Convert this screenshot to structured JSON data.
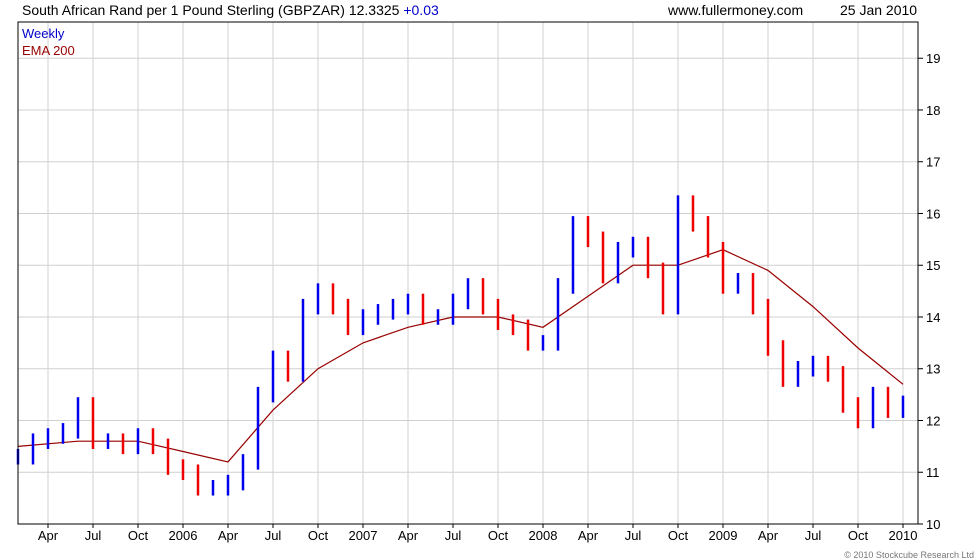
{
  "header": {
    "title": "South African Rand per 1 Pound Sterling (GBPZAR) 12.3325",
    "change": "+0.03",
    "site": "www.fullermoney.com",
    "date": "25 Jan 2010"
  },
  "legend": {
    "weekly": "Weekly",
    "ema": "EMA 200"
  },
  "copyright": "© 2010 Stockcube Research Ltd",
  "colors": {
    "up": "#0000ee",
    "down": "#ee0000",
    "ema": "#990000",
    "grid": "#d0d0d0",
    "axis": "#000000"
  },
  "chart_data": {
    "type": "line",
    "title": "South African Rand per 1 Pound Sterling (GBPZAR)",
    "ylim": [
      10,
      19.7
    ],
    "y_ticks": [
      10,
      11,
      12,
      13,
      14,
      15,
      16,
      17,
      18,
      19
    ],
    "x_ticks": [
      "Apr",
      "Jul",
      "Oct",
      "2006",
      "Apr",
      "Jul",
      "Oct",
      "2007",
      "Apr",
      "Jul",
      "Oct",
      "2008",
      "Apr",
      "Jul",
      "Oct",
      "2009",
      "Apr",
      "Jul",
      "Oct",
      "2010"
    ],
    "grid": true,
    "series": [
      {
        "name": "Weekly",
        "x": [
          "2005-02",
          "2005-03",
          "2005-04",
          "2005-05",
          "2005-06",
          "2005-07",
          "2005-08",
          "2005-09",
          "2005-10",
          "2005-11",
          "2005-12",
          "2006-01",
          "2006-02",
          "2006-03",
          "2006-04",
          "2006-05",
          "2006-06",
          "2006-07",
          "2006-08",
          "2006-09",
          "2006-10",
          "2006-11",
          "2006-12",
          "2007-01",
          "2007-02",
          "2007-03",
          "2007-04",
          "2007-05",
          "2007-06",
          "2007-07",
          "2007-08",
          "2007-09",
          "2007-10",
          "2007-11",
          "2007-12",
          "2008-01",
          "2008-02",
          "2008-03",
          "2008-04",
          "2008-05",
          "2008-06",
          "2008-07",
          "2008-08",
          "2008-09",
          "2008-10",
          "2008-11",
          "2008-12",
          "2009-01",
          "2009-02",
          "2009-03",
          "2009-04",
          "2009-05",
          "2009-06",
          "2009-07",
          "2009-08",
          "2009-09",
          "2009-10",
          "2009-11",
          "2009-12",
          "2010-01"
        ],
        "values": [
          11.3,
          11.6,
          11.7,
          11.8,
          12.3,
          11.6,
          11.6,
          11.5,
          11.7,
          11.5,
          11.1,
          11.0,
          10.7,
          10.7,
          10.8,
          11.2,
          12.5,
          13.2,
          12.9,
          14.2,
          14.5,
          14.2,
          13.8,
          14.0,
          14.1,
          14.2,
          14.3,
          14.0,
          14.0,
          14.3,
          14.6,
          14.2,
          13.9,
          13.8,
          13.5,
          13.5,
          14.6,
          15.8,
          15.5,
          14.8,
          15.3,
          15.4,
          14.9,
          14.2,
          16.2,
          15.8,
          15.3,
          14.6,
          14.7,
          14.2,
          13.4,
          12.8,
          13.0,
          13.1,
          12.9,
          12.3,
          12.0,
          12.5,
          12.2,
          12.33
        ]
      },
      {
        "name": "EMA 200",
        "x": [
          "2005-02",
          "2005-06",
          "2005-10",
          "2006-01",
          "2006-04",
          "2006-07",
          "2006-10",
          "2007-01",
          "2007-04",
          "2007-07",
          "2007-10",
          "2008-01",
          "2008-04",
          "2008-07",
          "2008-10",
          "2009-01",
          "2009-04",
          "2009-07",
          "2009-10",
          "2010-01"
        ],
        "values": [
          11.5,
          11.6,
          11.6,
          11.4,
          11.2,
          12.2,
          13.0,
          13.5,
          13.8,
          14.0,
          14.0,
          13.8,
          14.4,
          15.0,
          15.0,
          15.3,
          14.9,
          14.2,
          13.4,
          12.7
        ]
      }
    ]
  }
}
